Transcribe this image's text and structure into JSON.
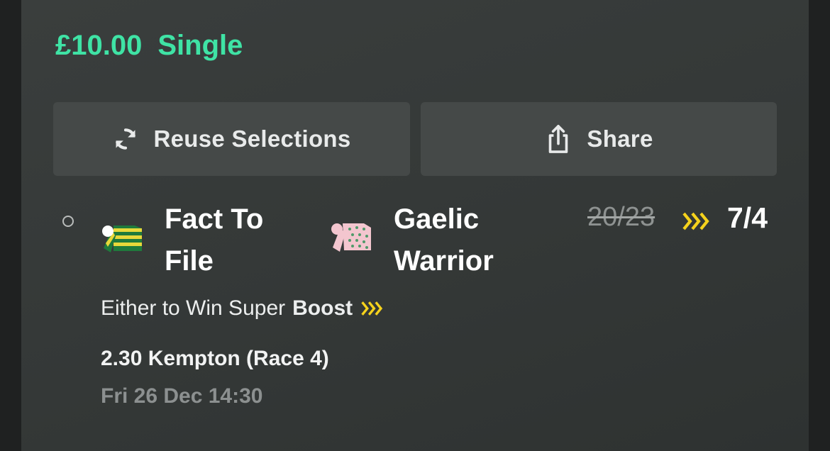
{
  "bet": {
    "stake": "£10.00",
    "type": "Single"
  },
  "actions": {
    "reuse_label": "Reuse Selections",
    "share_label": "Share"
  },
  "selection": {
    "runners": [
      "Fact To File",
      "Gaelic Warrior"
    ],
    "original_price": "20/23",
    "boosted_price": "7/4",
    "market_text": "Either to Win Super",
    "market_boost": "Boost",
    "race": "2.30 Kempton (Race 4)",
    "datetime": "Fri 26 Dec 14:30"
  },
  "colors": {
    "accent_green": "#3fe3a5",
    "boost_yellow": "#f5d21c",
    "background": "#363a39"
  },
  "icons": {
    "reuse": "refresh-icon",
    "share": "share-icon",
    "boost": "chevrons-right-icon",
    "silk_one": "jockey-silk-green-yellow-hoops",
    "silk_two": "jockey-silk-pink-spots"
  }
}
